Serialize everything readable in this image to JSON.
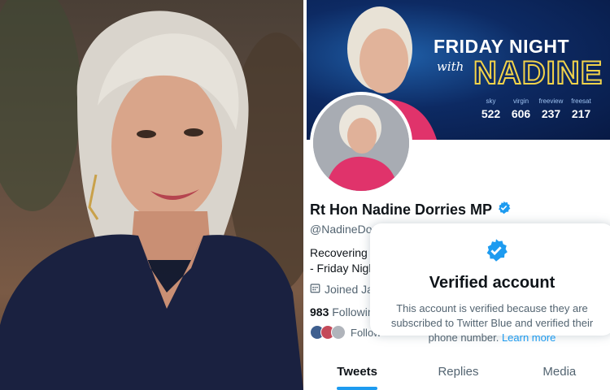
{
  "banner": {
    "title": "FRIDAY NIGHT",
    "with": "with",
    "name": "NADINE",
    "channels": [
      {
        "label": "sky",
        "number": "522"
      },
      {
        "label": "virgin",
        "number": "606"
      },
      {
        "label": "freeview",
        "number": "237"
      },
      {
        "label": "freesat",
        "number": "217"
      }
    ]
  },
  "profile": {
    "name": "Rt Hon Nadine Dorries MP",
    "handle": "@NadineDorri",
    "bio_line1": "Recovering S",
    "bio_line2": "- Friday Nigh",
    "joined": "Joined Ja",
    "following_count": "983",
    "following_label": "Following",
    "followers_label": "Follow"
  },
  "popover": {
    "title": "Verified account",
    "body": "This account is verified because they are subscribed to Twitter Blue and verified their phone number.",
    "link": "Learn more"
  },
  "tabs": [
    {
      "label": "Tweets"
    },
    {
      "label": "Replies"
    },
    {
      "label": "Media"
    }
  ],
  "colors": {
    "accent": "#1d9bf0",
    "banner_bg": "#0d2a63",
    "banner_name": "#f2d34a"
  }
}
